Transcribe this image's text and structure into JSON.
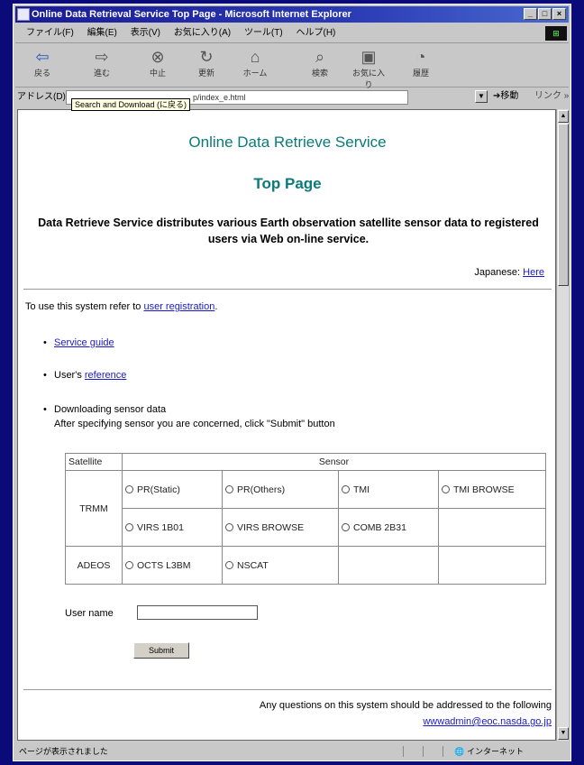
{
  "window": {
    "title": "Online Data Retrieval Service Top Page - Microsoft Internet Explorer",
    "menu": [
      "ファイル(F)",
      "編集(E)",
      "表示(V)",
      "お気に入り(A)",
      "ツール(T)",
      "ヘルプ(H)"
    ],
    "toolbar": [
      {
        "label": "戻る",
        "icon": "back-arrow-icon"
      },
      {
        "label": "進む",
        "icon": "forward-arrow-icon"
      },
      {
        "label": "中止",
        "icon": "stop-icon"
      },
      {
        "label": "更新",
        "icon": "refresh-icon"
      },
      {
        "label": "ホーム",
        "icon": "home-icon"
      },
      {
        "label": "検索",
        "icon": "search-icon"
      },
      {
        "label": "お気に入り",
        "icon": "favorites-icon"
      },
      {
        "label": "履歴",
        "icon": "history-icon"
      }
    ],
    "address_label": "アドレス(D)",
    "address_value": "p/index_e.html",
    "tooltip": "Search and Download (に戻る)",
    "go_label": "移動",
    "links_label": "リンク »",
    "status_text": "ページが表示されました",
    "zone_text": "インターネット"
  },
  "page": {
    "title": "Online Data Retrieve Service",
    "subtitle": "Top Page",
    "intro": "Data Retrieve Service distributes various Earth observation satellite sensor data to registered users via Web on-line service.",
    "japanese_prefix": "Japanese:",
    "japanese_link": "Here",
    "use_text": "To use this system refer to",
    "use_link": "user registration",
    "use_suffix": ".",
    "service_guide": "Service guide",
    "users_prefix": "User's",
    "users_link": "reference",
    "download_title": "Downloading sensor data",
    "download_desc": "After specifying sensor you are concerned, click \"Submit\" button",
    "table": {
      "h_satellite": "Satellite",
      "h_sensor": "Sensor",
      "trmm": "TRMM",
      "adeos": "ADEOS",
      "pr_static": "PR(Static)",
      "pr_others": "PR(Others)",
      "tmi": "TMI",
      "tmi_browse": "TMI BROWSE",
      "virs_1b01": "VIRS 1B01",
      "virs_browse": "VIRS BROWSE",
      "comb_2b31": "COMB 2B31",
      "octs_l3bm": "OCTS L3BM",
      "nscat": "NSCAT"
    },
    "user_name_label": "User name",
    "submit_label": "Submit",
    "footer_text": "Any questions on this system should be addressed to the following",
    "footer_email": "wwwadmin@eoc.nasda.go.jp"
  },
  "colors": {
    "heading": "#0a7a7a",
    "link": "#1a1acc",
    "title_bar": "#1a1a96",
    "desktop": "#0a0a78"
  }
}
